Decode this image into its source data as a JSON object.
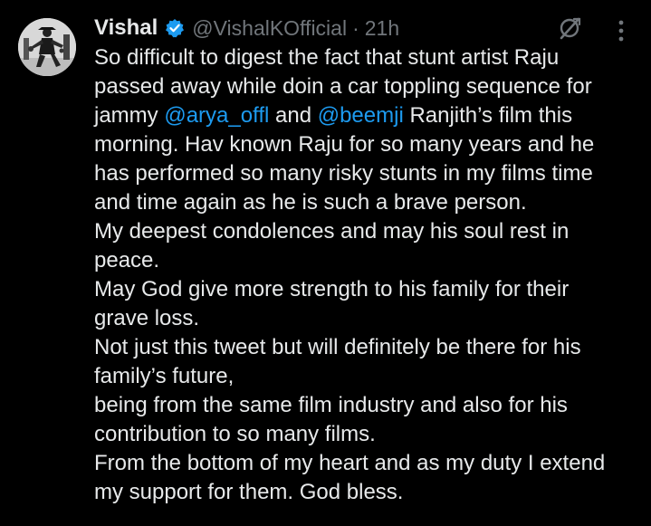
{
  "tweet": {
    "author_name": "Vishal",
    "handle": "@VishalKOfficial",
    "separator": "·",
    "time": "21h",
    "icons": {
      "verified": "verified-badge-icon",
      "grok": "grok-icon",
      "more": "more-options-icon"
    },
    "colors": {
      "background": "#000000",
      "text": "#e7e9ea",
      "secondary": "#71767b",
      "link": "#1d9bf0",
      "verified": "#1d9bf0"
    },
    "body": {
      "l1": "So difficult to digest the fact that stunt artist Raju",
      "l2": "passed away while doin a car toppling sequence for",
      "l3_a": "jammy ",
      "l3_mention1": "@arya_offl",
      "l3_b": " and ",
      "l3_mention2": "@beemji",
      "l3_c": " Ranjith’s film this",
      "l4": "morning. Hav known Raju for so many years and he",
      "l5": "has performed so many risky stunts in my films time",
      "l6": "and time again as he is such a brave person.",
      "l7": "My deepest condolences and may his soul rest in",
      "l8": "peace.",
      "l9": "May God give more strength to his family for their",
      "l10": "grave loss.",
      "l11": "Not just this tweet but will definitely be there for his",
      "l12": "family’s future,",
      "l13": "being from the same film industry and also for his",
      "l14": "contribution to so many films.",
      "l15": "From the bottom of my heart and as my duty I extend",
      "l16": "my support for them.  God bless."
    }
  }
}
